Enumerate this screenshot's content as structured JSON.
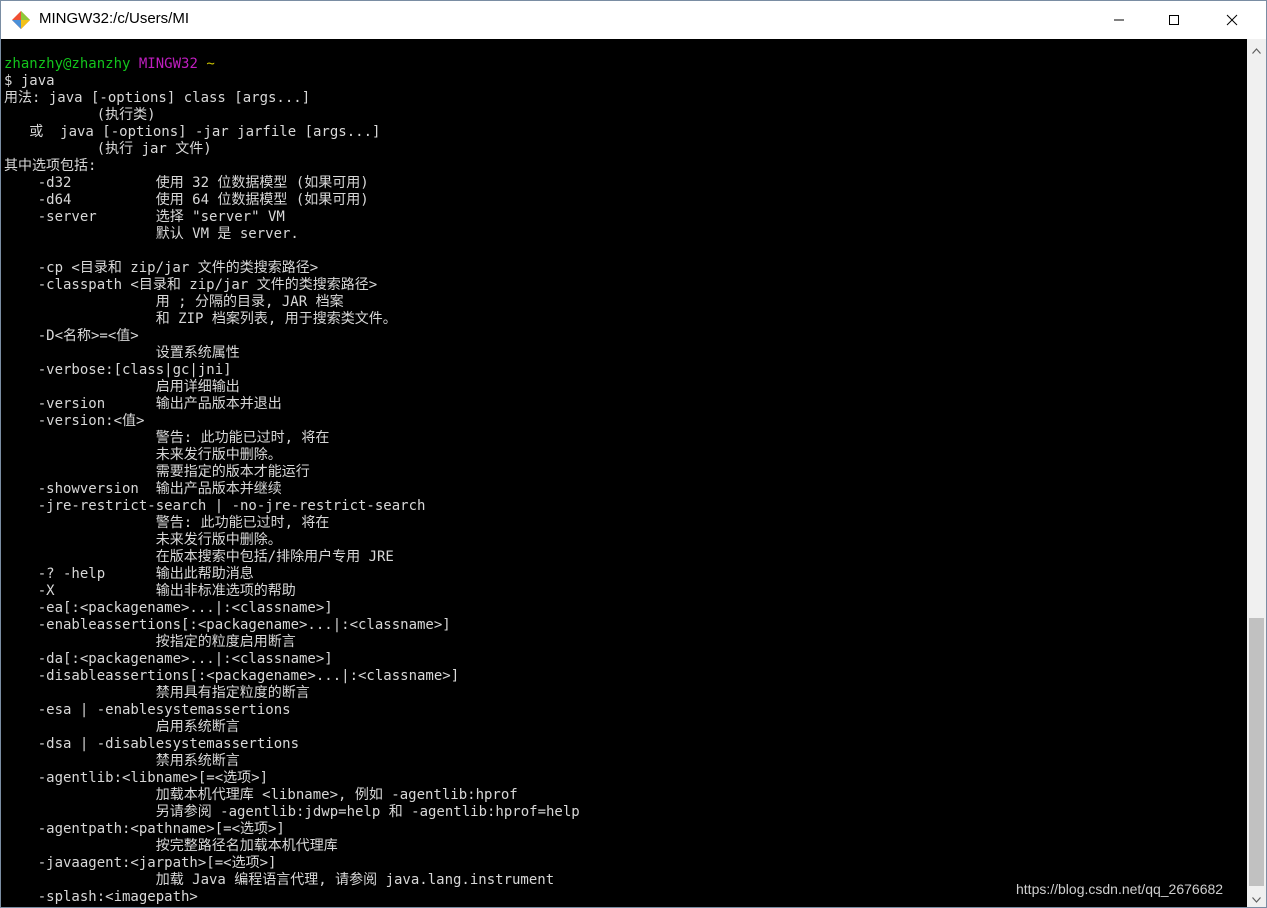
{
  "window": {
    "title": "MINGW32:/c/Users/MI"
  },
  "prompt": {
    "user_host": "zhanzhy@zhanzhy",
    "env": "MINGW32",
    "path": "~",
    "command": "$ java"
  },
  "output": [
    "用法: java [-options] class [args...]",
    "           (执行类)",
    "   或  java [-options] -jar jarfile [args...]",
    "           (执行 jar 文件)",
    "其中选项包括:",
    "    -d32          使用 32 位数据模型 (如果可用)",
    "    -d64          使用 64 位数据模型 (如果可用)",
    "    -server       选择 \"server\" VM",
    "                  默认 VM 是 server.",
    "",
    "    -cp <目录和 zip/jar 文件的类搜索路径>",
    "    -classpath <目录和 zip/jar 文件的类搜索路径>",
    "                  用 ; 分隔的目录, JAR 档案",
    "                  和 ZIP 档案列表, 用于搜索类文件。",
    "    -D<名称>=<值>",
    "                  设置系统属性",
    "    -verbose:[class|gc|jni]",
    "                  启用详细输出",
    "    -version      输出产品版本并退出",
    "    -version:<值>",
    "                  警告: 此功能已过时, 将在",
    "                  未来发行版中删除。",
    "                  需要指定的版本才能运行",
    "    -showversion  输出产品版本并继续",
    "    -jre-restrict-search | -no-jre-restrict-search",
    "                  警告: 此功能已过时, 将在",
    "                  未来发行版中删除。",
    "                  在版本搜索中包括/排除用户专用 JRE",
    "    -? -help      输出此帮助消息",
    "    -X            输出非标准选项的帮助",
    "    -ea[:<packagename>...|:<classname>]",
    "    -enableassertions[:<packagename>...|:<classname>]",
    "                  按指定的粒度启用断言",
    "    -da[:<packagename>...|:<classname>]",
    "    -disableassertions[:<packagename>...|:<classname>]",
    "                  禁用具有指定粒度的断言",
    "    -esa | -enablesystemassertions",
    "                  启用系统断言",
    "    -dsa | -disablesystemassertions",
    "                  禁用系统断言",
    "    -agentlib:<libname>[=<选项>]",
    "                  加载本机代理库 <libname>, 例如 -agentlib:hprof",
    "                  另请参阅 -agentlib:jdwp=help 和 -agentlib:hprof=help",
    "    -agentpath:<pathname>[=<选项>]",
    "                  按完整路径名加载本机代理库",
    "    -javaagent:<jarpath>[=<选项>]",
    "                  加载 Java 编程语言代理, 请参阅 java.lang.instrument",
    "    -splash:<imagepath>"
  ],
  "watermark": "https://blog.csdn.net/qq_2676682",
  "colors": {
    "terminal_bg": "#000000",
    "text": "#d8d8d8",
    "user_host": "#13c51c",
    "env": "#bf1ebf",
    "path": "#c8c000"
  }
}
